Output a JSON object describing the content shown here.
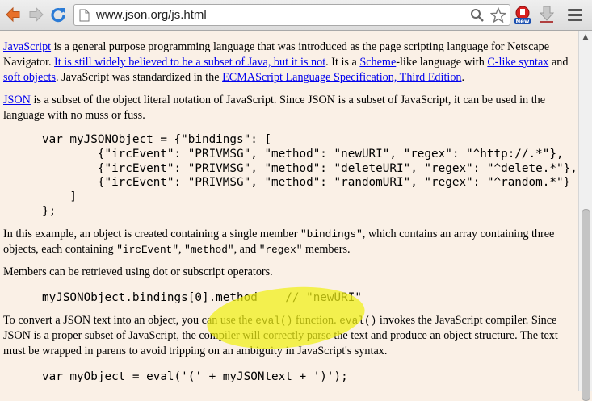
{
  "browser": {
    "url": "www.json.org/js.html",
    "ext_badge": "New",
    "colors": {
      "back_arrow": "#e8702a",
      "reload": "#2b7bd6"
    }
  },
  "paragraphs": {
    "p1": {
      "link_javascript": "JavaScript",
      "t1": " is a general purpose programming language that was introduced as the page scripting language for Netscape Navigator. ",
      "link_subset_java": "It is still widely believed to be a subset of Java, but it is not",
      "t2": ". It is a ",
      "link_scheme": "Scheme",
      "t3": "-like language with ",
      "link_c_syntax": "C-like syntax",
      "t4": " and ",
      "link_soft_objects": "soft objects",
      "t5": ". JavaScript was standardized in the ",
      "link_ecma": "ECMAScript Language Specification, Third Edition",
      "t6": "."
    },
    "p2": {
      "link_json": "JSON",
      "t1": " is a subset of the object literal notation of JavaScript. Since JSON is a subset of JavaScript, it can be used in the language with no muss or fuss."
    },
    "p3": {
      "t1": "In this example, an object is created containing a single member ",
      "c1": "\"bindings\"",
      "t2": ", which contains an array containing three objects, each containing ",
      "c2": "\"ircEvent\"",
      "t3": ", ",
      "c3": "\"method\"",
      "t4": ", and ",
      "c4": "\"regex\"",
      "t5": " members."
    },
    "p4": {
      "t1": "Members can be retrieved using dot or subscript operators."
    },
    "p5": {
      "t1": "To convert a JSON text into an object, you can use the ",
      "c1": "eval()",
      "t2": " function. ",
      "c2": "eval()",
      "t3": " invokes the JavaScript compiler. Since JSON is a proper subset of JavaScript, the compiler will correctly parse the text and produce an object structure. The text must be wrapped in parens to avoid tripping on an ambiguity in JavaScript's syntax."
    }
  },
  "code": {
    "block1": "var myJSONObject = {\"bindings\": [\n        {\"ircEvent\": \"PRIVMSG\", \"method\": \"newURI\", \"regex\": \"^http://.*\"},\n        {\"ircEvent\": \"PRIVMSG\", \"method\": \"deleteURI\", \"regex\": \"^delete.*\"},\n        {\"ircEvent\": \"PRIVMSG\", \"method\": \"randomURI\", \"regex\": \"^random.*\"}\n    ]\n};",
    "block2": "myJSONObject.bindings[0].method    // \"newURI\"",
    "block3": "var myObject = eval('(' + myJSONtext + ')');"
  },
  "highlight_color": "#f0f014"
}
